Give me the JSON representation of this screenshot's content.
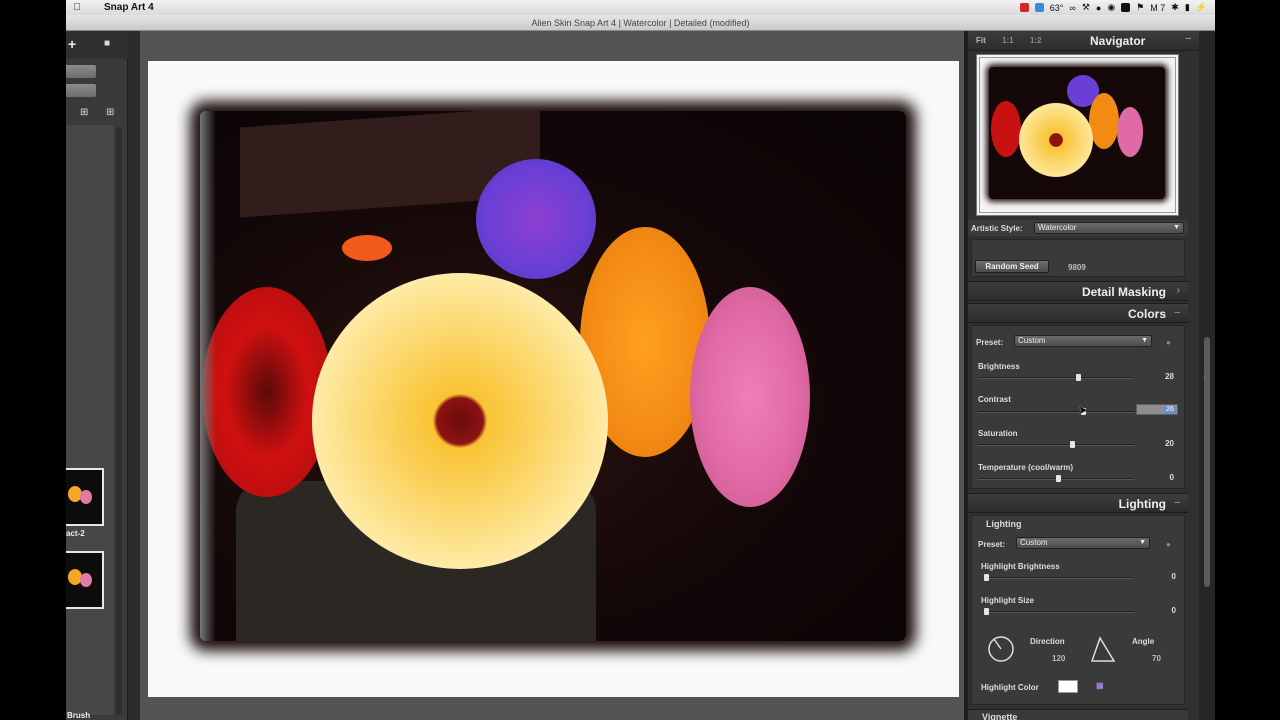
{
  "menubar": {
    "app_name": "Snap Art 4",
    "temperature": "63°",
    "status_extra": "M 7"
  },
  "window": {
    "title": "Alien Skin Snap Art 4 | Watercolor | Detailed (modified)"
  },
  "left_panel": {
    "thumbs": [
      {
        "label": "act-2"
      },
      {
        "label": "Brush"
      }
    ]
  },
  "navigator": {
    "title": "Navigator",
    "zoom_fit": "Fit",
    "zoom_1": "1:1",
    "zoom_2": "1:2"
  },
  "artistic_style": {
    "label": "Artistic Style:",
    "value": "Watercolor"
  },
  "random_seed": {
    "button": "Random Seed",
    "value": "9809"
  },
  "sections": {
    "detail_masking": "Detail Masking",
    "colors": "Colors",
    "lighting": "Lighting"
  },
  "colors": {
    "preset_label": "Preset:",
    "preset_value": "Custom",
    "brightness": {
      "label": "Brightness",
      "value": "28"
    },
    "contrast": {
      "label": "Contrast",
      "value": "26"
    },
    "saturation": {
      "label": "Saturation",
      "value": "20"
    },
    "temperature": {
      "label": "Temperature (cool/warm)",
      "value": "0"
    }
  },
  "lighting": {
    "group_label": "Lighting",
    "preset_label": "Preset:",
    "preset_value": "Custom",
    "highlight_brightness": {
      "label": "Highlight Brightness",
      "value": "0"
    },
    "highlight_size": {
      "label": "Highlight Size",
      "value": "0"
    },
    "direction": {
      "label": "Direction",
      "value": "120"
    },
    "angle": {
      "label": "Angle",
      "value": "70"
    },
    "highlight_color_label": "Highlight Color",
    "highlight_color": "#ffffff",
    "vignette_label": "Vignette"
  }
}
